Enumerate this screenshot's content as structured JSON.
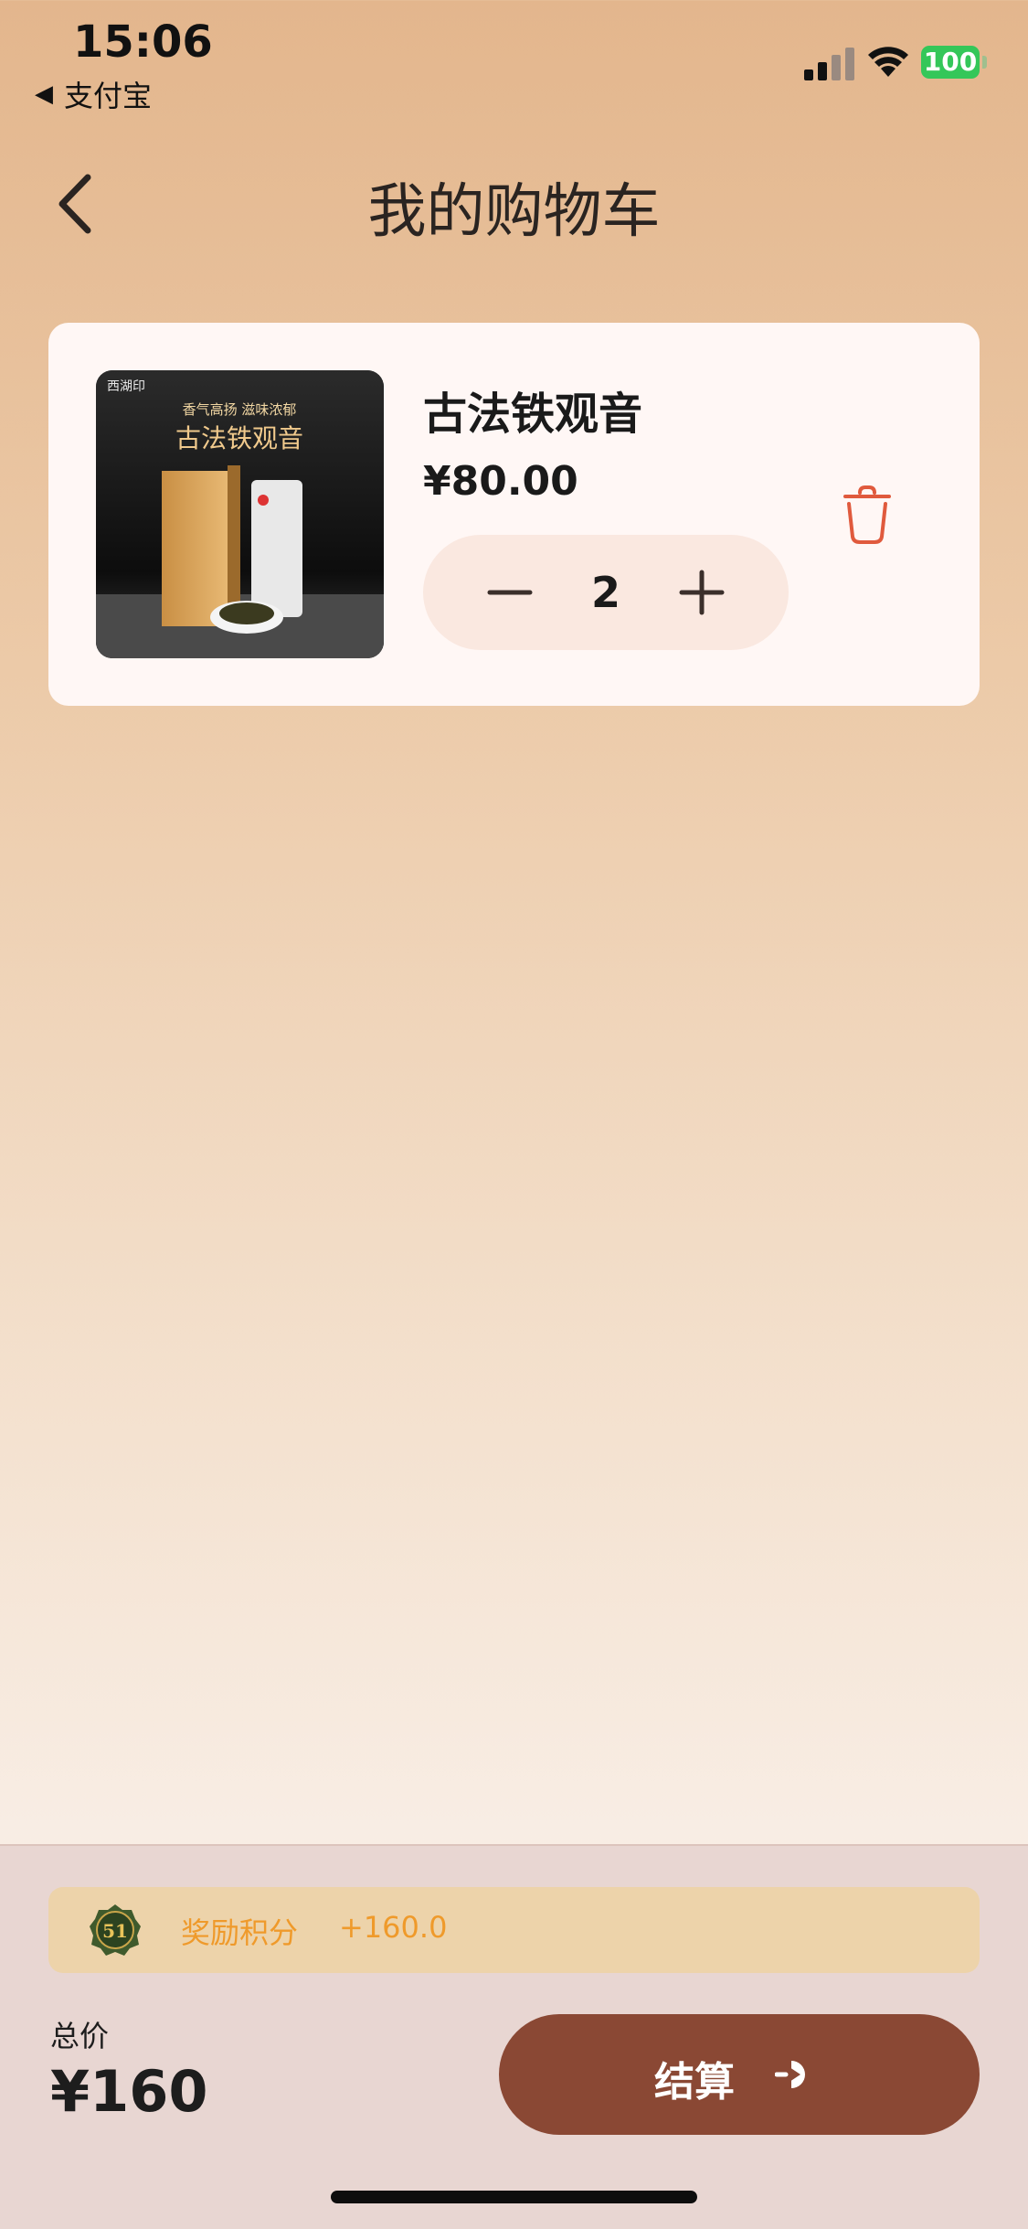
{
  "status_bar": {
    "time": "15:06",
    "back_app": "支付宝",
    "battery": "100"
  },
  "nav": {
    "title": "我的购物车"
  },
  "cart": {
    "items": [
      {
        "name": "古法铁观音",
        "price": "¥80.00",
        "quantity": "2",
        "image_text": {
          "brand": "西湖印",
          "slogan": "香气高扬  滋味浓郁",
          "title": "古法铁观音"
        }
      }
    ]
  },
  "reward": {
    "badge": "51",
    "label": "奖励积分",
    "points": "+160.0"
  },
  "total": {
    "label": "总价",
    "value": "¥160"
  },
  "checkout": {
    "label": "结算"
  },
  "colors": {
    "accent": "#8a4834",
    "reward_text": "#ef9a2b",
    "delete_icon": "#e05a3d",
    "battery": "#34c759"
  }
}
